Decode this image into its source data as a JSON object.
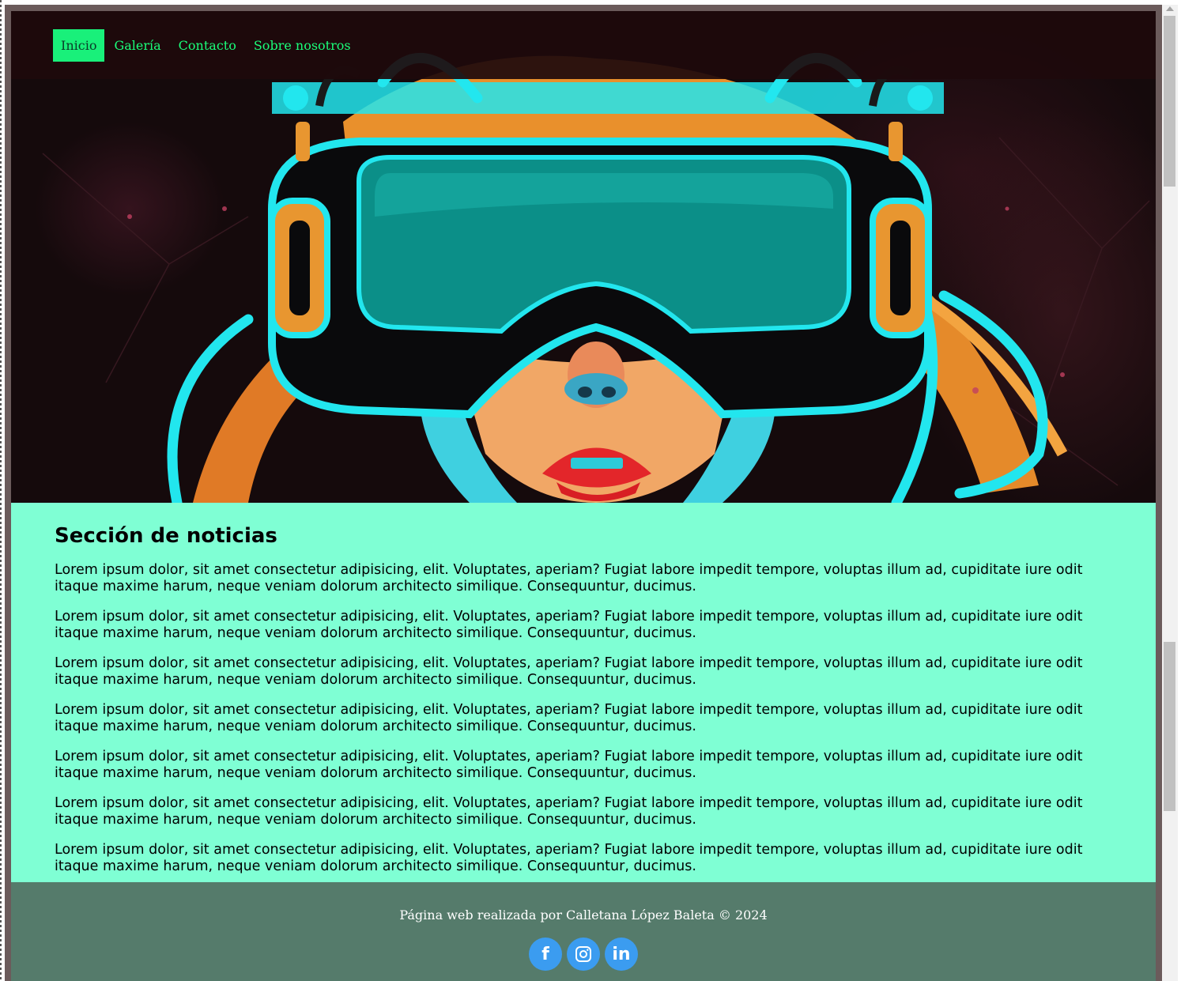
{
  "nav": {
    "items": [
      {
        "label": "Inicio",
        "active": true
      },
      {
        "label": "Galería",
        "active": false
      },
      {
        "label": "Contacto",
        "active": false
      },
      {
        "label": "Sobre nosotros",
        "active": false
      }
    ]
  },
  "news": {
    "title": "Sección de noticias",
    "paragraphs": [
      "Lorem ipsum dolor, sit amet consectetur adipisicing, elit. Voluptates, aperiam? Fugiat labore impedit tempore, voluptas illum ad, cupiditate iure odit itaque maxime harum, neque veniam dolorum architecto similique. Consequuntur, ducimus.",
      "Lorem ipsum dolor, sit amet consectetur adipisicing, elit. Voluptates, aperiam? Fugiat labore impedit tempore, voluptas illum ad, cupiditate iure odit itaque maxime harum, neque veniam dolorum architecto similique. Consequuntur, ducimus.",
      "Lorem ipsum dolor, sit amet consectetur adipisicing, elit. Voluptates, aperiam? Fugiat labore impedit tempore, voluptas illum ad, cupiditate iure odit itaque maxime harum, neque veniam dolorum architecto similique. Consequuntur, ducimus.",
      "Lorem ipsum dolor, sit amet consectetur adipisicing, elit. Voluptates, aperiam? Fugiat labore impedit tempore, voluptas illum ad, cupiditate iure odit itaque maxime harum, neque veniam dolorum architecto similique. Consequuntur, ducimus.",
      "Lorem ipsum dolor, sit amet consectetur adipisicing, elit. Voluptates, aperiam? Fugiat labore impedit tempore, voluptas illum ad, cupiditate iure odit itaque maxime harum, neque veniam dolorum architecto similique. Consequuntur, ducimus.",
      "Lorem ipsum dolor, sit amet consectetur adipisicing, elit. Voluptates, aperiam? Fugiat labore impedit tempore, voluptas illum ad, cupiditate iure odit itaque maxime harum, neque veniam dolorum architecto similique. Consequuntur, ducimus.",
      "Lorem ipsum dolor, sit amet consectetur adipisicing, elit. Voluptates, aperiam? Fugiat labore impedit tempore, voluptas illum ad, cupiditate iure odit itaque maxime harum, neque veniam dolorum architecto similique. Consequuntur, ducimus."
    ]
  },
  "footer": {
    "credit": "Página web realizada por Calletana López Baleta © 2024",
    "socials": [
      {
        "label": "f",
        "icon": "facebook-icon"
      },
      {
        "label": "◎",
        "icon": "instagram-icon"
      },
      {
        "label": "in",
        "icon": "linkedin-icon"
      }
    ]
  },
  "colors": {
    "nav_link": "#1aff7a",
    "nav_active_bg": "#19f07a",
    "news_bg": "#7fffd4",
    "footer_bg": "#557b6b",
    "social_bg": "#3b9cf0"
  },
  "hero": {
    "icon": "vr-headset-illustration"
  }
}
